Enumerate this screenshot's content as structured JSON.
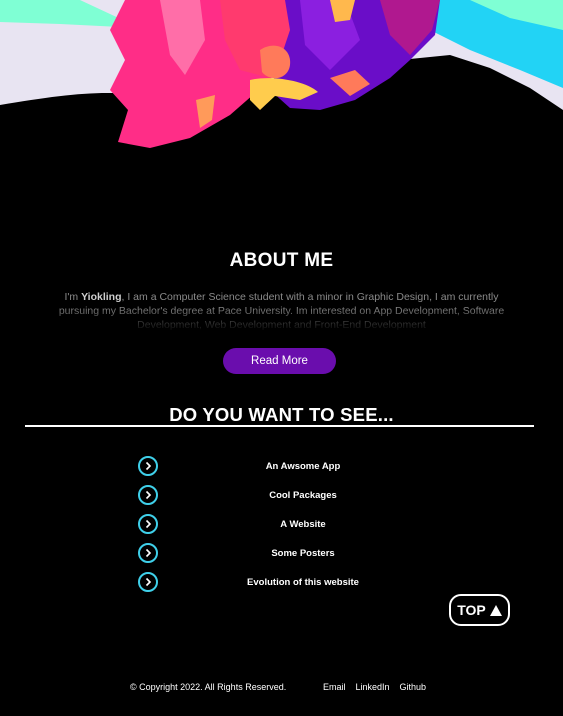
{
  "about": {
    "title": "ABOUT ME",
    "text_prefix": "I'm ",
    "name": "Yiokling",
    "text_body": ", I am a Computer Science student with a minor in Graphic Design, I am currently pursuing my Bachelor's degree at Pace University. Im interested on App Development, Software Development, Web Development and Front-End Development",
    "read_more_label": "Read More"
  },
  "see": {
    "title": "DO YOU WANT TO SEE...",
    "items": [
      {
        "label": "An Awsome App"
      },
      {
        "label": "Cool Packages"
      },
      {
        "label": "A Website"
      },
      {
        "label": "Some Posters"
      },
      {
        "label": "Evolution of this website"
      }
    ]
  },
  "top_button": {
    "label": "TOP"
  },
  "footer": {
    "copyright": "© Copyright 2022. All Rights Reserved.",
    "links": {
      "email": "Email",
      "linkedin": "LinkedIn",
      "github": "Github"
    }
  },
  "colors": {
    "accent_purple": "#6a0dad",
    "circle_cyan": "#3fd0ea",
    "background": "#000000"
  }
}
